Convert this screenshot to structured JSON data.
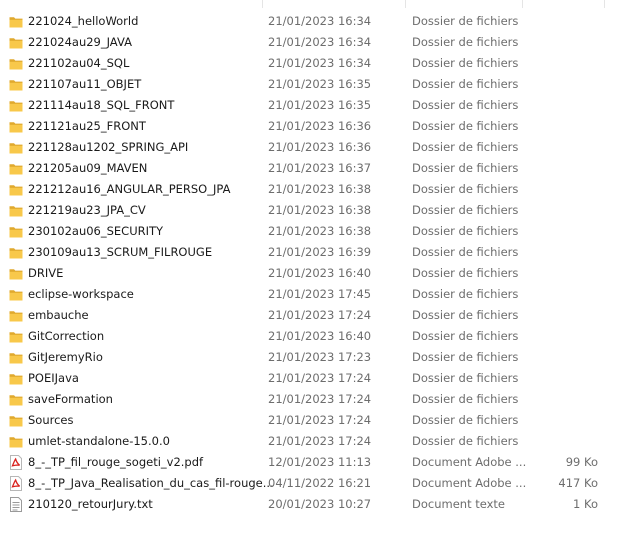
{
  "colors": {
    "folder": "#f8c84a",
    "folder_dark": "#e0a92e",
    "pdf": "#d9231f",
    "row_hover": "#e5f3ff",
    "meta_text": "#6d6d6d"
  },
  "files": [
    {
      "name": "221024_helloWorld",
      "date": "21/01/2023 16:34",
      "type": "Dossier de fichiers",
      "size": "",
      "icon": "folder-icon"
    },
    {
      "name": "221024au29_JAVA",
      "date": "21/01/2023 16:34",
      "type": "Dossier de fichiers",
      "size": "",
      "icon": "folder-icon"
    },
    {
      "name": "221102au04_SQL",
      "date": "21/01/2023 16:34",
      "type": "Dossier de fichiers",
      "size": "",
      "icon": "folder-icon"
    },
    {
      "name": "221107au11_OBJET",
      "date": "21/01/2023 16:35",
      "type": "Dossier de fichiers",
      "size": "",
      "icon": "folder-icon"
    },
    {
      "name": "221114au18_SQL_FRONT",
      "date": "21/01/2023 16:35",
      "type": "Dossier de fichiers",
      "size": "",
      "icon": "folder-icon"
    },
    {
      "name": "221121au25_FRONT",
      "date": "21/01/2023 16:36",
      "type": "Dossier de fichiers",
      "size": "",
      "icon": "folder-icon"
    },
    {
      "name": "221128au1202_SPRING_API",
      "date": "21/01/2023 16:36",
      "type": "Dossier de fichiers",
      "size": "",
      "icon": "folder-icon"
    },
    {
      "name": "221205au09_MAVEN",
      "date": "21/01/2023 16:37",
      "type": "Dossier de fichiers",
      "size": "",
      "icon": "folder-icon"
    },
    {
      "name": "221212au16_ANGULAR_PERSO_JPA",
      "date": "21/01/2023 16:38",
      "type": "Dossier de fichiers",
      "size": "",
      "icon": "folder-icon"
    },
    {
      "name": "221219au23_JPA_CV",
      "date": "21/01/2023 16:38",
      "type": "Dossier de fichiers",
      "size": "",
      "icon": "folder-icon"
    },
    {
      "name": "230102au06_SECURITY",
      "date": "21/01/2023 16:38",
      "type": "Dossier de fichiers",
      "size": "",
      "icon": "folder-icon"
    },
    {
      "name": "230109au13_SCRUM_FILROUGE",
      "date": "21/01/2023 16:39",
      "type": "Dossier de fichiers",
      "size": "",
      "icon": "folder-icon"
    },
    {
      "name": "DRIVE",
      "date": "21/01/2023 16:40",
      "type": "Dossier de fichiers",
      "size": "",
      "icon": "folder-icon"
    },
    {
      "name": "eclipse-workspace",
      "date": "21/01/2023 17:45",
      "type": "Dossier de fichiers",
      "size": "",
      "icon": "folder-icon"
    },
    {
      "name": "embauche",
      "date": "21/01/2023 17:24",
      "type": "Dossier de fichiers",
      "size": "",
      "icon": "folder-icon"
    },
    {
      "name": "GitCorrection",
      "date": "21/01/2023 16:40",
      "type": "Dossier de fichiers",
      "size": "",
      "icon": "folder-icon"
    },
    {
      "name": "GitJeremyRio",
      "date": "21/01/2023 17:23",
      "type": "Dossier de fichiers",
      "size": "",
      "icon": "folder-icon"
    },
    {
      "name": "POEIJava",
      "date": "21/01/2023 17:24",
      "type": "Dossier de fichiers",
      "size": "",
      "icon": "folder-icon"
    },
    {
      "name": "saveFormation",
      "date": "21/01/2023 17:24",
      "type": "Dossier de fichiers",
      "size": "",
      "icon": "folder-icon"
    },
    {
      "name": "Sources",
      "date": "21/01/2023 17:24",
      "type": "Dossier de fichiers",
      "size": "",
      "icon": "folder-icon"
    },
    {
      "name": "umlet-standalone-15.0.0",
      "date": "21/01/2023 17:24",
      "type": "Dossier de fichiers",
      "size": "",
      "icon": "folder-icon"
    },
    {
      "name": "8_-_TP_fil_rouge_sogeti_v2.pdf",
      "date": "12/01/2023 11:13",
      "type": "Document Adobe ...",
      "size": "99 Ko",
      "icon": "pdf-icon"
    },
    {
      "name": "8_-_TP_Java_Realisation_du_cas_fil-rouge...",
      "date": "04/11/2022 16:21",
      "type": "Document Adobe ...",
      "size": "417 Ko",
      "icon": "pdf-icon"
    },
    {
      "name": "210120_retourJury.txt",
      "date": "20/01/2023 10:27",
      "type": "Document texte",
      "size": "1 Ko",
      "icon": "text-file-icon"
    }
  ]
}
